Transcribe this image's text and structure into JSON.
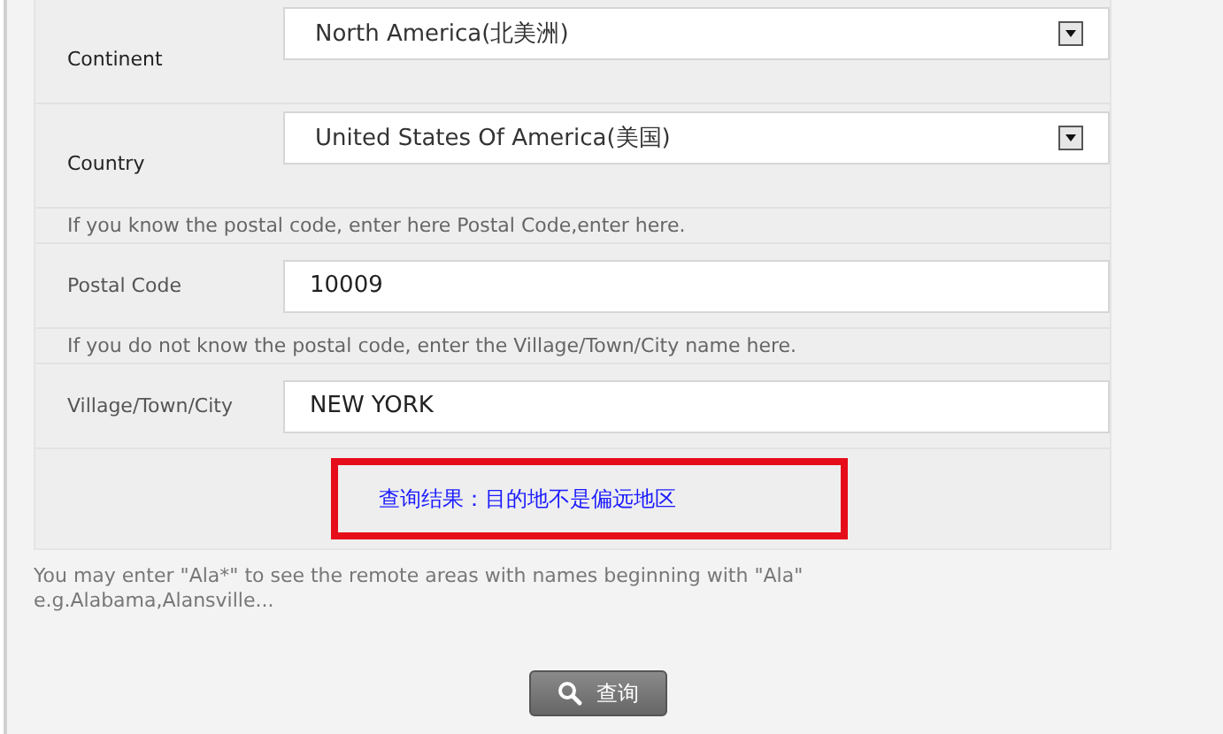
{
  "form": {
    "rows": [
      {
        "kind": "select",
        "label": "Continent",
        "value": "North America(北美洲)"
      },
      {
        "kind": "select",
        "label": "Country",
        "value": "United States Of America(美国)"
      },
      {
        "kind": "note",
        "text": "If you know the postal code, enter here Postal Code,enter here."
      },
      {
        "kind": "input",
        "label": "Postal Code",
        "value": "10009"
      },
      {
        "kind": "note",
        "text": "If you do not know the postal code, enter the Village/Town/City name here."
      },
      {
        "kind": "input",
        "label": "Village/Town/City",
        "value": "NEW YORK"
      }
    ],
    "result": "查询结果：目的地不是偏远地区"
  },
  "hint": [
    "You may enter \"Ala*\" to see the remote areas with names beginning with \"Ala\"",
    "e.g.Alabama,Alansville..."
  ],
  "search_button": "查询"
}
